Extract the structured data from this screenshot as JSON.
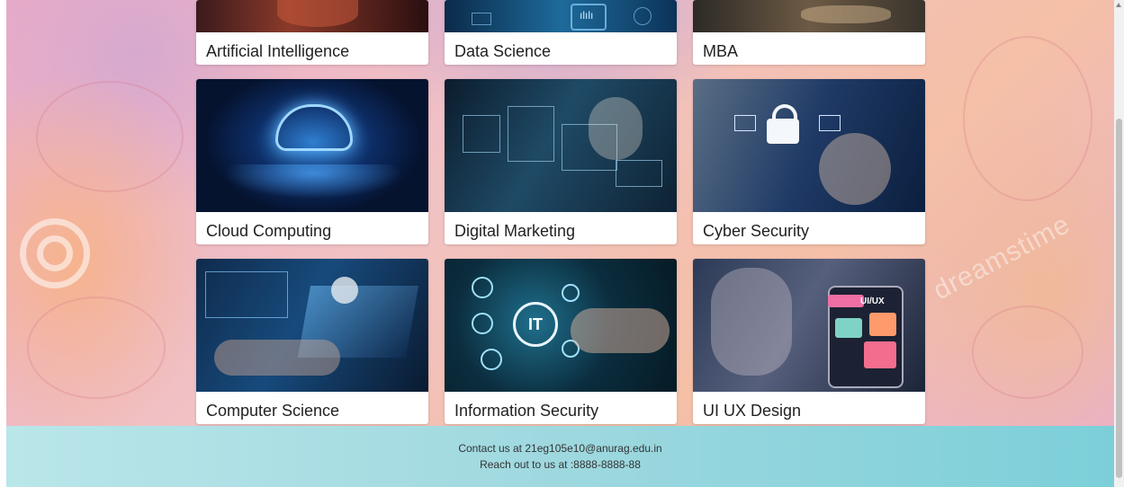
{
  "courses": [
    {
      "label": "Artificial Intelligence"
    },
    {
      "label": "Data Science"
    },
    {
      "label": "MBA"
    },
    {
      "label": "Cloud Computing"
    },
    {
      "label": "Digital Marketing"
    },
    {
      "label": "Cyber Security"
    },
    {
      "label": "Computer Science"
    },
    {
      "label": "Information Security"
    },
    {
      "label": "UI UX Design"
    }
  ],
  "images": {
    "data_science_icon_text": "ılılı",
    "cs_badge": "IT",
    "ux_badge": "UI/UX"
  },
  "watermark": "dreamstime",
  "footer": {
    "contact": "Contact us at 21eg105e10@anurag.edu.in",
    "phone": "Reach out to us at :8888-8888-88"
  },
  "colors": {
    "footer_start": "#b9e6e9",
    "footer_end": "#7ccfd9",
    "card_bg": "#ffffff"
  }
}
